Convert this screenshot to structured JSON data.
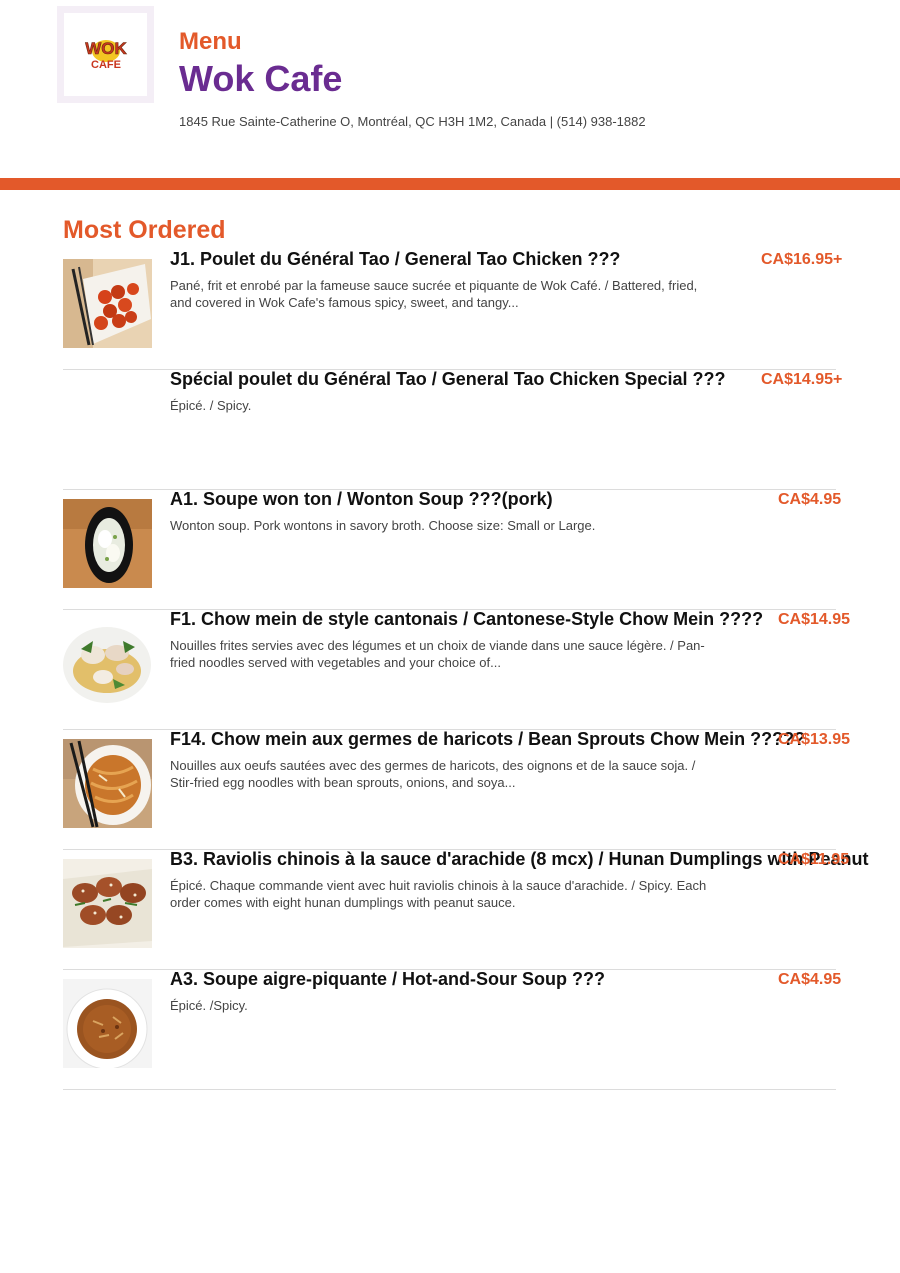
{
  "header": {
    "logo_text_top": "WOK",
    "logo_text_bottom": "CAFE",
    "menu_label": "Menu",
    "restaurant_name": "Wok Cafe",
    "address_line": "1845 Rue Sainte-Catherine O, Montréal, QC H3H 1M2, Canada | (514) 938-1882"
  },
  "colors": {
    "accent": "#e3592a",
    "brand": "#6a2c91"
  },
  "section": {
    "title": "Most Ordered"
  },
  "items": [
    {
      "title": "J1. Poulet du Général Tao / General Tao Chicken  ???",
      "description": "Pané, frit et enrobé par la fameuse sauce sucrée et piquante de Wok Café. / Battered, fried, and covered in Wok Cafe's famous spicy, sweet, and tangy...",
      "price": "CA$16.95+",
      "image": "general-tao-chicken-photo"
    },
    {
      "title": "Spécial poulet du Général Tao / General Tao Chicken Special  ???",
      "description": "Épicé. / Spicy.",
      "price": "CA$14.95+",
      "image": ""
    },
    {
      "title": "A1. Soupe won ton / Wonton Soup ???(pork)",
      "description": "Wonton soup. Pork wontons in savory broth. Choose size: Small or Large.",
      "price": "CA$4.95",
      "image": "wonton-soup-photo"
    },
    {
      "title": "F1. Chow mein de style cantonais / Cantonese-Style Chow Mein ????",
      "description": "Nouilles frites servies avec des légumes et un choix de viande dans une sauce légère. / Pan-fried noodles served with vegetables and your choice of...",
      "price": "CA$14.95",
      "image": "cantonese-chow-mein-photo"
    },
    {
      "title": "F14. Chow mein aux germes de haricots / Bean Sprouts Chow Mein ?????",
      "description": "Nouilles aux oeufs sautées avec des germes de haricots, des oignons et de la sauce soja. / Stir-fried egg noodles with bean sprouts, onions, and soya...",
      "price": "CA$13.95",
      "image": "bean-sprouts-chow-mein-photo"
    },
    {
      "title": "B3. Raviolis chinois à la sauce d'arachide (8 mcx) / Hunan Dumplings with Peanut",
      "description": "Épicé. Chaque commande vient avec huit raviolis chinois à la sauce d'arachide. / Spicy. Each order comes with eight hunan dumplings with peanut sauce.",
      "price": "CA$11.95",
      "image": "hunan-dumplings-photo"
    },
    {
      "title": "A3. Soupe aigre-piquante / Hot-and-Sour Soup ???",
      "description": "Épicé. /Spicy.",
      "price": "CA$4.95",
      "image": "hot-and-sour-soup-photo"
    }
  ]
}
